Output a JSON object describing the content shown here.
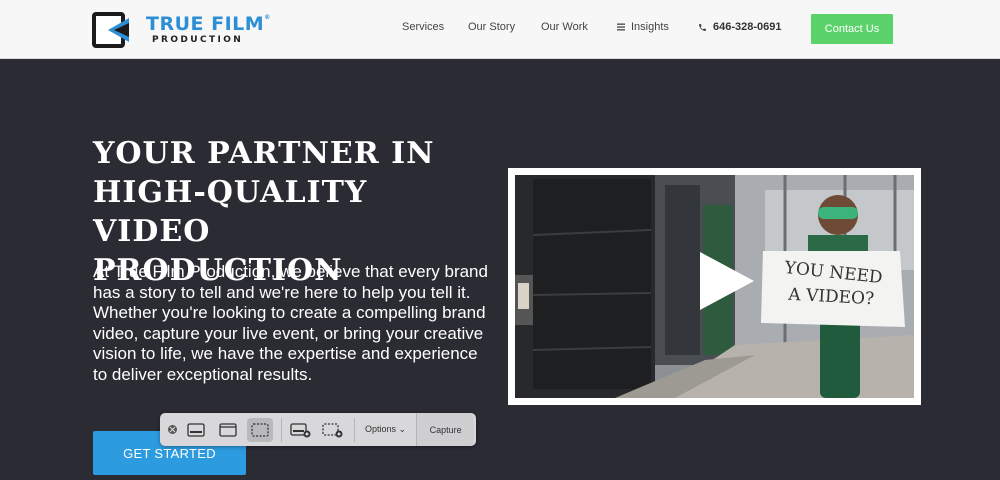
{
  "brand": {
    "title": "TRUE FILM",
    "subtitle": "PRODUCTION",
    "trademark": "®",
    "accent_color": "#2c8fd6"
  },
  "nav": {
    "items": [
      {
        "label": "Services"
      },
      {
        "label": "Our Story"
      },
      {
        "label": "Our Work"
      },
      {
        "label": "Insights",
        "icon": "menu-icon"
      }
    ],
    "phone": "646-328-0691",
    "phone_icon": "phone-icon",
    "contact_label": "Contact Us",
    "contact_color": "#5cd26a"
  },
  "hero": {
    "title_lines": [
      "YOUR PARTNER IN",
      "HIGH-QUALITY VIDEO",
      "PRODUCTION"
    ],
    "text": "At True Film Production, we believe that every brand has a story to tell and we're here to help you tell it. Whether you're looking to create a compelling brand video, capture your live event, or bring your creative vision to life, we have the expertise and experience to deliver exceptional results.",
    "cta_label": "GET STARTED",
    "cta_color": "#2d9be0",
    "background_color": "#2a2b33"
  },
  "video": {
    "sign_lines": [
      "YOU NEED",
      "A VIDEO?"
    ],
    "play_icon": "play-icon"
  },
  "toolbar": {
    "options_label": "Options",
    "capture_label": "Capture",
    "icons": [
      "close-icon",
      "capture-window-icon",
      "capture-screen-icon",
      "capture-selection-icon",
      "record-screen-icon",
      "record-selection-icon"
    ]
  }
}
